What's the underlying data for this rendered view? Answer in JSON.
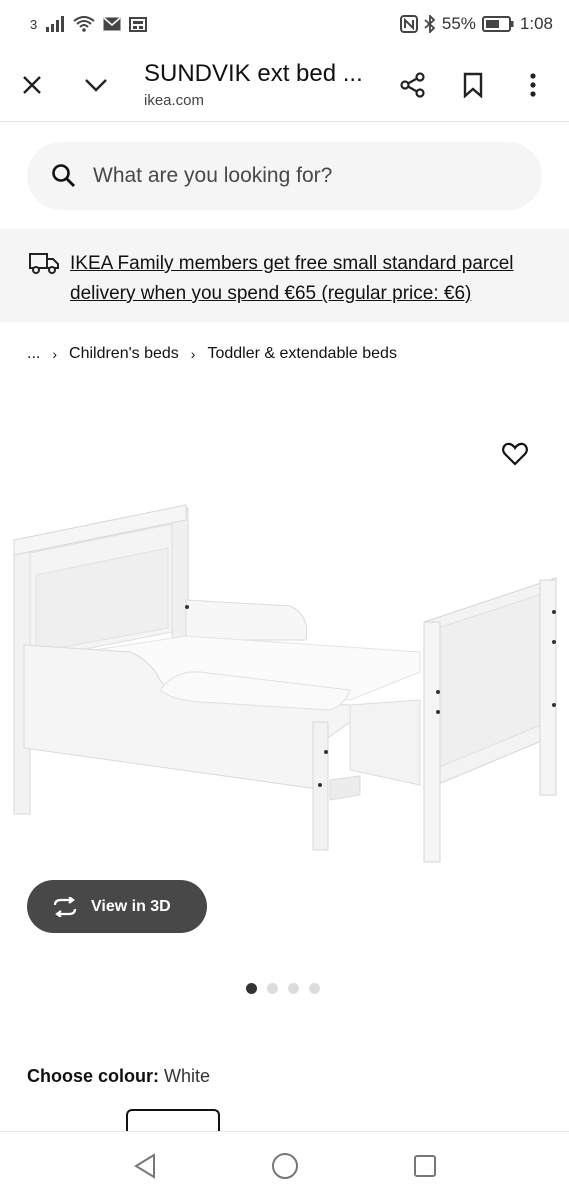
{
  "status_bar": {
    "sim_label": "3",
    "battery": "55%",
    "time": "1:08"
  },
  "toolbar": {
    "title": "SUNDVIK ext bed ...",
    "url": "ikea.com"
  },
  "search": {
    "placeholder": "What are you looking for?"
  },
  "banner": {
    "text": "IKEA Family members get free small standard parcel delivery when you spend €65 (regular price: €6)"
  },
  "breadcrumb": {
    "items": [
      "...",
      "Children's beds",
      "Toddler & extendable beds"
    ]
  },
  "product": {
    "view3d_label": "View in 3D",
    "image_count": 4,
    "active_image": 1
  },
  "colour": {
    "label": "Choose colour:",
    "value": "White"
  }
}
